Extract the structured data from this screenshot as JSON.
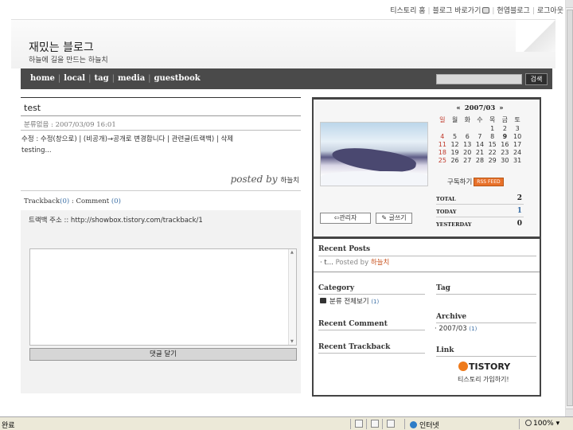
{
  "topbar": {
    "links": [
      "티스토리 홈",
      "블로그 바로가기",
      "현엽블로그",
      "로그아웃"
    ]
  },
  "blog": {
    "title": "재밌는 블로그",
    "description": "하늘에 길을 만드는 하늘치"
  },
  "nav": {
    "items": [
      "home",
      "local",
      "tag",
      "media",
      "guestbook"
    ],
    "search_button": "검색"
  },
  "post": {
    "title": "test",
    "category": "분류없음",
    "datetime": "2007/03/09 16:01",
    "actions": "수정 : 수정(창으로) | (비공개)→공개로 변경합니다 | 관련글(트랙백) | 삭제",
    "body": "testing...",
    "posted_by_label": "posted by",
    "author": "하늘치"
  },
  "trackback": {
    "label": "Trackback",
    "count": "(0)",
    "separator": " : ",
    "comment_label": "Comment",
    "comment_count": "(0)",
    "address": "트랙백 주소 :: http://showbox.tistory.com/trackback/1"
  },
  "comment_form": {
    "submit_label": "댓글 달기"
  },
  "sidebar": {
    "admin_button": "관리자",
    "write_button": "글쓰기",
    "calendar": {
      "prev": "«",
      "month": "2007/03",
      "next": "»",
      "weekdays": [
        "일",
        "월",
        "화",
        "수",
        "목",
        "금",
        "토"
      ],
      "weeks": [
        [
          "",
          "",
          "",
          "",
          "1",
          "2",
          "3"
        ],
        [
          "4",
          "5",
          "6",
          "7",
          "8",
          "9",
          "10"
        ],
        [
          "11",
          "12",
          "13",
          "14",
          "15",
          "16",
          "17"
        ],
        [
          "18",
          "19",
          "20",
          "21",
          "22",
          "23",
          "24"
        ],
        [
          "25",
          "26",
          "27",
          "28",
          "29",
          "30",
          "31"
        ]
      ]
    },
    "subscribe_label": "구독하기",
    "rss_label": "RSS FEED",
    "counter": {
      "total_label": "TOTAL",
      "total": "2",
      "today_label": "TODAY",
      "today": "1",
      "yesterday_label": "YESTERDAY",
      "yesterday": "0"
    },
    "recent_posts_title": "Recent Posts",
    "recent_post_item": "t...",
    "recent_post_by": "Posted by",
    "recent_post_author": "하늘치",
    "category_title": "Category",
    "category_item": "분류 전체보기",
    "category_count": "(1)",
    "tag_title": "Tag",
    "recent_comment_title": "Recent Comment",
    "archive_title": "Archive",
    "archive_item": "2007/03",
    "archive_count": "(1)",
    "recent_trackback_title": "Recent Trackback",
    "link_title": "Link",
    "tistory_logo": "TISTORY",
    "tistory_join": "티스토리 가입하기!"
  },
  "statusbar": {
    "status": "완료",
    "zone": "인터넷",
    "zoom": "100%"
  },
  "colors": {
    "nav_bg": "#4a4a4a",
    "sunday_red": "#c0392b",
    "link_blue": "#3a6ea5",
    "author_orange": "#c8531f",
    "rss_orange": "#e8712a"
  }
}
